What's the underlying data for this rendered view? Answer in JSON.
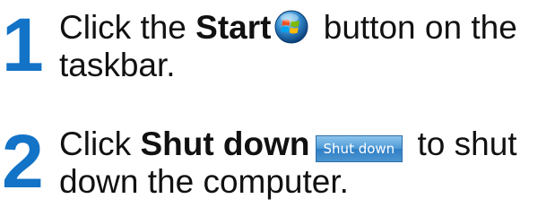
{
  "steps": [
    {
      "number": "1",
      "before": "Click the ",
      "bold": "Start",
      "after": " button on the taskbar.",
      "icon": "windows-start-orb-icon"
    },
    {
      "number": "2",
      "before": "Click ",
      "bold": "Shut down",
      "button_label": "Shut down",
      "after": " to shut down the computer."
    }
  ],
  "colors": {
    "step_number": "#1273c7",
    "text": "#111111",
    "shutdown_button": "#4f9ad6"
  }
}
